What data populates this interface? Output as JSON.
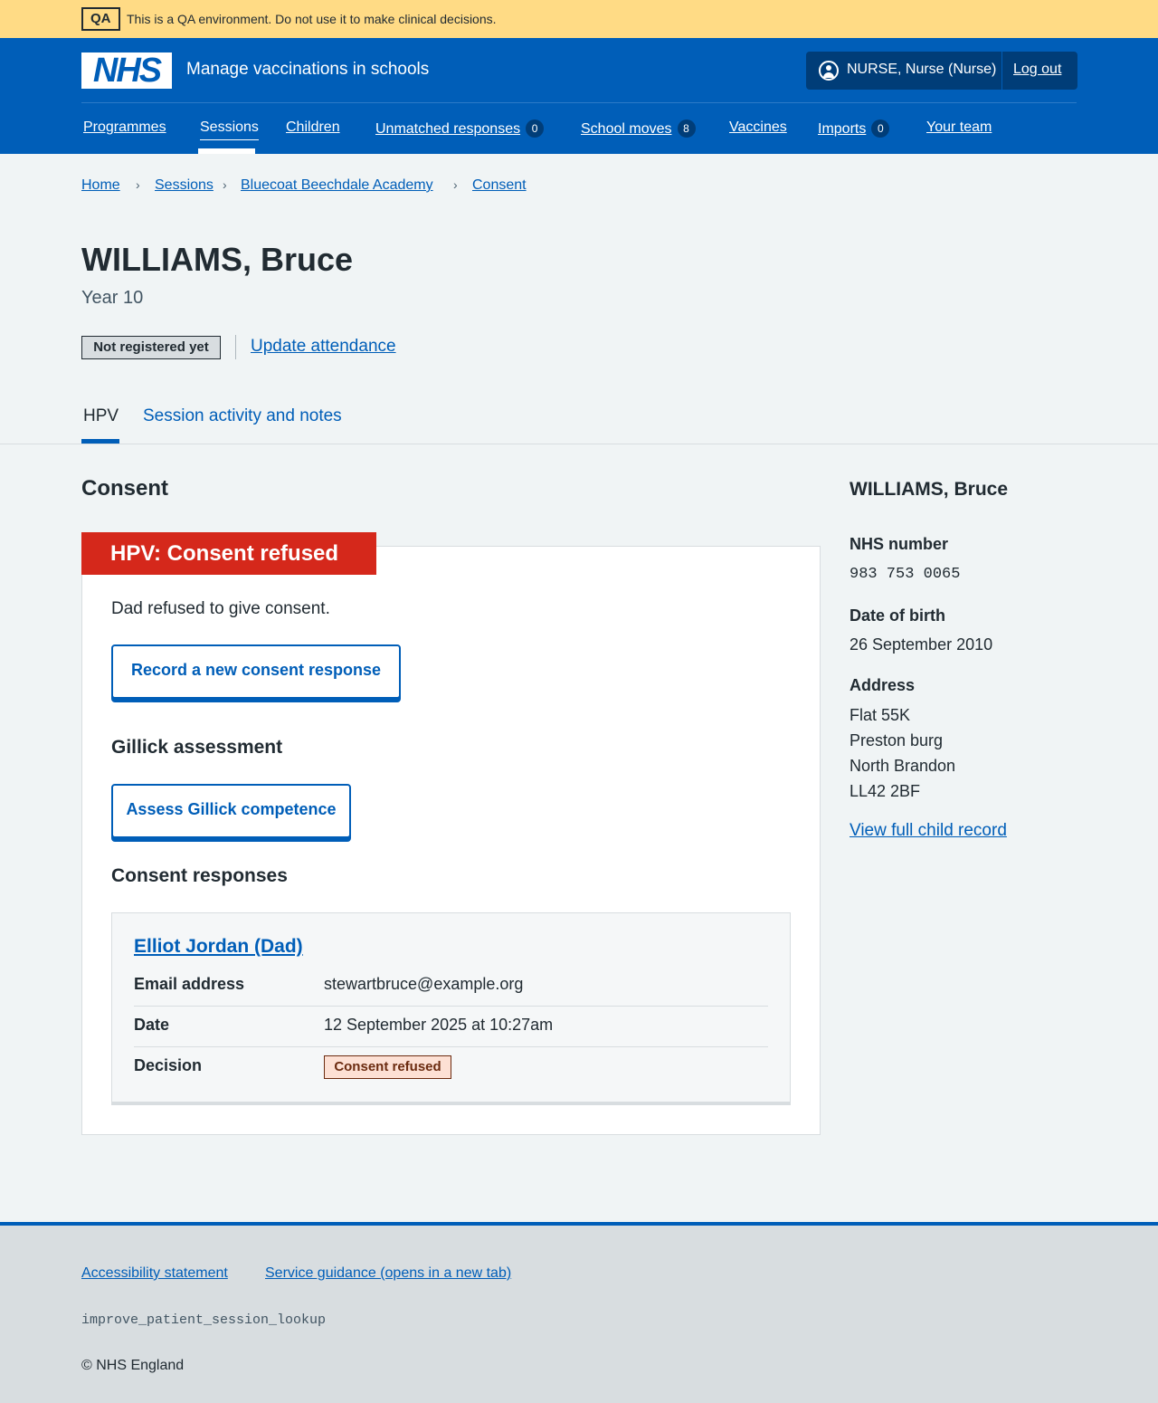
{
  "qa_banner": {
    "tag": "QA",
    "text": "This is a QA environment. Do not use it to make clinical decisions."
  },
  "header": {
    "logo": "NHS",
    "service_name": "Manage vaccinations in schools",
    "account_name": "NURSE, Nurse (Nurse)",
    "account_icon": "user-icon",
    "logout_label": "Log out",
    "nav": [
      {
        "label": "Programmes"
      },
      {
        "label": "Sessions",
        "active": true
      },
      {
        "label": "Children"
      },
      {
        "label": "Unmatched responses",
        "badge": "0"
      },
      {
        "label": "School moves",
        "badge": "8"
      },
      {
        "label": "Vaccines"
      },
      {
        "label": "Imports",
        "badge": "0"
      },
      {
        "label": "Your team"
      }
    ]
  },
  "breadcrumb": [
    "Home",
    "Sessions",
    "Bluecoat Beechdale Academy",
    "Consent"
  ],
  "patient": {
    "name": "WILLIAMS, Bruce",
    "year": "Year 10",
    "registration_status": "Not registered yet",
    "update_attendance_label": "Update attendance"
  },
  "tabs": [
    {
      "label": "HPV",
      "active": true
    },
    {
      "label": "Session activity and notes"
    }
  ],
  "consent": {
    "title": "Consent",
    "status_heading": "HPV: Consent refused",
    "summary": "Dad refused to give consent.",
    "record_button": "Record a new consent response",
    "gillick_title": "Gillick assessment",
    "gillick_button": "Assess Gillick competence",
    "responses_title": "Consent responses",
    "response": {
      "name": "Elliot Jordan (Dad)",
      "rows": [
        {
          "key": "Email address",
          "value": "stewartbruce@example.org"
        },
        {
          "key": "Date",
          "value": "12 September 2025 at 10:27am"
        },
        {
          "key": "Decision",
          "value": "Consent refused"
        }
      ]
    }
  },
  "sidebar": {
    "name": "WILLIAMS, Bruce",
    "nhs_number_label": "NHS number",
    "nhs_number": "983 753 0065",
    "dob_label": "Date of birth",
    "dob": "26 September 2010",
    "address_label": "Address",
    "address": [
      "Flat 55K",
      "Preston burg",
      "North Brandon",
      "LL42 2BF"
    ],
    "record_link": "View full child record"
  },
  "footer": {
    "links": [
      "Accessibility statement",
      "Service guidance (opens in a new tab)"
    ],
    "code": "improve_patient_session_lookup",
    "copyright": "© NHS England"
  },
  "colors": {
    "nhs_blue": "#005eb8",
    "refused_red": "#d5281b",
    "qa_yellow": "#ffdb85",
    "page_bg": "#f0f4f5"
  }
}
